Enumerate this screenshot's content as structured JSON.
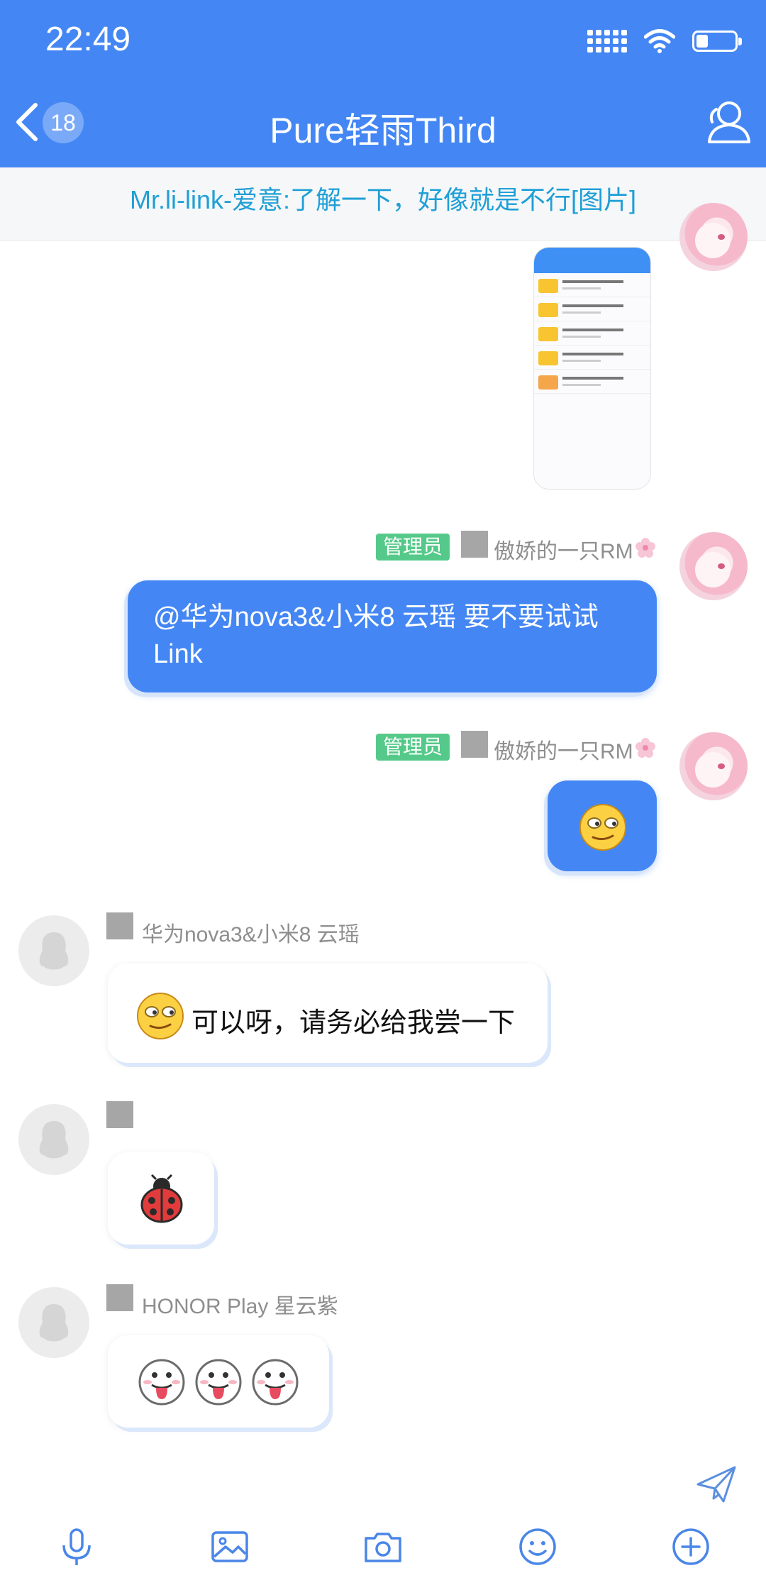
{
  "status_bar": {
    "time": "22:49"
  },
  "header": {
    "unread_badge": "18",
    "title": "Pure轻雨Third"
  },
  "notice": {
    "text": "Mr.li-link-爱意:了解一下，好像就是不行[图片]"
  },
  "messages": [
    {
      "role": "管理员",
      "nick": "傲娇的一只RM",
      "text": "@华为nova3&小米8 云瑶 要不要试试Link"
    },
    {
      "role": "管理员",
      "nick": "傲娇的一只RM"
    },
    {
      "nick": "华为nova3&小米8 云瑶",
      "text": "可以呀，请务必给我尝一下"
    },
    {
      "nick": ""
    },
    {
      "nick": "HONOR   Play 星云紫"
    }
  ],
  "colors": {
    "header": "#4487f4",
    "notice_text": "#1f9fd6",
    "role_badge": "#55c989"
  },
  "icons": [
    "back-chevron-icon",
    "members-icon",
    "send-icon",
    "microphone-icon",
    "image-icon",
    "camera-icon",
    "emoji-icon",
    "plus-icon"
  ]
}
